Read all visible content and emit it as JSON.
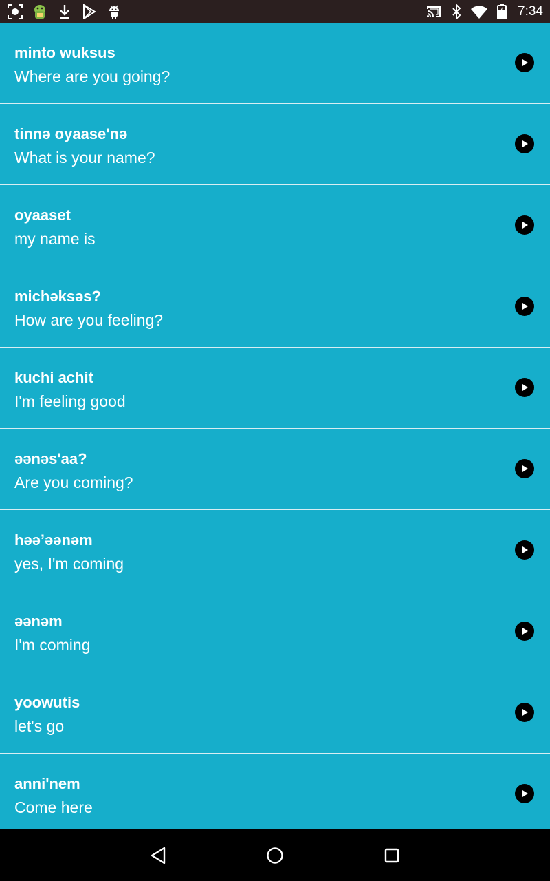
{
  "status_bar": {
    "time": "7:34",
    "left_icons": [
      "screenshot-icon",
      "android-debug-icon",
      "download-icon",
      "play-store-icon",
      "android-icon"
    ],
    "right_icons": [
      "cast-icon",
      "bluetooth-icon",
      "wifi-icon",
      "battery-icon"
    ]
  },
  "phrases": [
    {
      "native": "minto wuksus",
      "english": "Where are you going?"
    },
    {
      "native": "tinnə oyaase'nə",
      "english": "What is your name?"
    },
    {
      "native": "oyaaset",
      "english": "my name is"
    },
    {
      "native": "michəksəs?",
      "english": "How are you feeling?"
    },
    {
      "native": "kuchi achit",
      "english": "I'm feeling good"
    },
    {
      "native": "əənəs'aa?",
      "english": "Are you coming?"
    },
    {
      "native": "həə’əənəm",
      "english": "yes, I'm coming"
    },
    {
      "native": "əənəm",
      "english": "I'm coming"
    },
    {
      "native": "yoowutis",
      "english": "let's go"
    },
    {
      "native": "anni'nem",
      "english": "Come here"
    }
  ],
  "nav_bar": {
    "buttons": [
      "back-icon",
      "home-icon",
      "recents-icon"
    ]
  },
  "colors": {
    "background": "#16aecb",
    "status_bar": "#2b1f1f",
    "nav_bar": "#000000",
    "divider": "#d8eef3",
    "text": "#ffffff"
  }
}
